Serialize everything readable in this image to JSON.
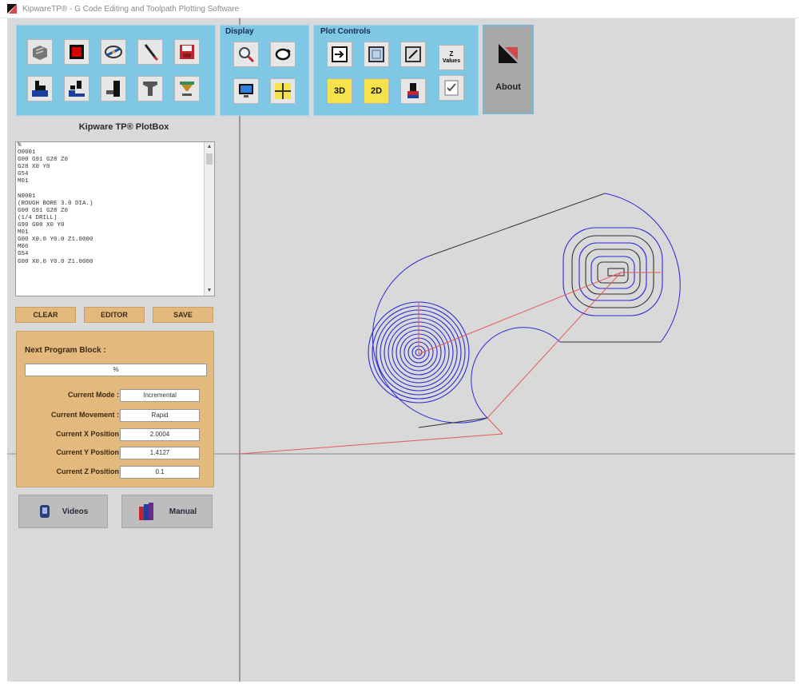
{
  "window": {
    "title": "KipwareTP® - G Code Editing and Toolpath Plotting Software"
  },
  "toolbar": {
    "main_buttons": [
      {
        "name": "open-file-button",
        "icon": "open-file-icon"
      },
      {
        "name": "stop-button",
        "icon": "stop-icon"
      },
      {
        "name": "disk-program-button",
        "icon": "disk-program-icon"
      },
      {
        "name": "edit-pen-button",
        "icon": "pen-icon"
      },
      {
        "name": "save-disk-button",
        "icon": "floppy-disk-icon"
      },
      {
        "name": "mill-operation-button",
        "icon": "mill-part-icon"
      },
      {
        "name": "mill-pocket-button",
        "icon": "mill-pocket-icon"
      },
      {
        "name": "lathe-profile-button",
        "icon": "lathe-profile-icon"
      },
      {
        "name": "tool-holder-button",
        "icon": "tool-holder-icon"
      },
      {
        "name": "chamfer-tool-button",
        "icon": "chamfer-tool-icon"
      }
    ],
    "display_title": "Display",
    "display_buttons": [
      {
        "name": "zoom-button",
        "icon": "magnifier-icon"
      },
      {
        "name": "rotate-view-button",
        "icon": "rotate-icon"
      },
      {
        "name": "monitor-button",
        "icon": "monitor-icon"
      },
      {
        "name": "axis-origin-button",
        "icon": "crosshair-icon"
      }
    ],
    "plot_title": "Plot Controls",
    "plot_buttons": [
      {
        "name": "step-plot-button",
        "icon": "step-arrow-icon"
      },
      {
        "name": "full-plot-button",
        "icon": "square-frame-icon"
      },
      {
        "name": "clear-plot-button",
        "icon": "clear-slash-icon"
      },
      {
        "name": "z-values-button",
        "icon": "z-values-icon",
        "label_top": "Z",
        "label_bottom": "Values"
      },
      {
        "name": "view-3d-button",
        "icon": "view-3d-icon",
        "label": "3D"
      },
      {
        "name": "view-2d-button",
        "icon": "view-2d-icon",
        "label": "2D"
      },
      {
        "name": "tool-view-button",
        "icon": "tool-view-icon"
      },
      {
        "name": "checklist-button",
        "icon": "checklist-icon"
      }
    ],
    "about_label": "About"
  },
  "left_panel": {
    "title": "Kipware TP®   PlotBox",
    "gcode_lines": [
      "%",
      "O0001",
      "G00 G91 G28 Z0",
      "G28 X0 Y0",
      "G54",
      "M01",
      "",
      "N0001",
      "(ROUGH BORE 3.0 DIA.)",
      "G00 G91 G28 Z0",
      "(1/4 DRILL)",
      "G90 G00 X0 Y0",
      "M01",
      "G00 X0.0 Y0.0 Z1.0000",
      "M06",
      "G54",
      "G00 X0.0 Y0.0 Z1.0000"
    ],
    "buttons": {
      "clear": "CLEAR",
      "editor": "EDITOR",
      "save": "SAVE"
    },
    "next_block_label": "Next Program Block :",
    "next_block_value": "%",
    "rows": [
      {
        "label": "Current Mode :",
        "value": "Incremental"
      },
      {
        "label": "Current Movement :",
        "value": "Rapid"
      },
      {
        "label": "Current X Position",
        "value": "2.0004"
      },
      {
        "label": "Current Y Position",
        "value": "1.4127"
      },
      {
        "label": "Current Z Position",
        "value": "0.1"
      }
    ],
    "videos_label": "Videos",
    "manual_label": "Manual"
  },
  "colors": {
    "panel_blue": "#7ec8e6",
    "status_tan": "#e4b97e",
    "plot_bg": "#d9d9d9",
    "path_blue": "#2a2ad6",
    "path_black": "#333333",
    "rapid_red": "#e35a5a"
  }
}
